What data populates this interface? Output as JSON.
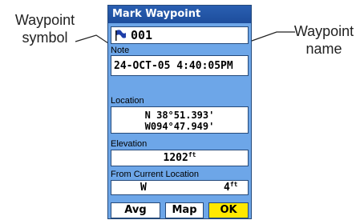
{
  "callouts": {
    "left": [
      "Waypoint",
      "symbol"
    ],
    "right": [
      "Waypoint",
      "name"
    ]
  },
  "screen": {
    "title": "Mark Waypoint",
    "waypoint_symbol_icon": "flag-icon",
    "waypoint_name": "001",
    "note_label": "Note",
    "note_value": "24-OCT-05 4:40:05PM",
    "location_label": "Location",
    "location_lat": "N  38°51.393'",
    "location_lon": "W094°47.949'",
    "elevation_label": "Elevation",
    "elevation_value": "1202",
    "elevation_unit": "ft",
    "from_label": "From Current Location",
    "bearing_dir": "W",
    "distance_value": "4",
    "distance_unit": "ft"
  },
  "buttons": {
    "avg": "Avg",
    "map": "Map",
    "ok": "OK"
  },
  "colors": {
    "background": "#6da6e8",
    "title_bar": "#1d4d9c",
    "ok_button": "#ffe800"
  }
}
